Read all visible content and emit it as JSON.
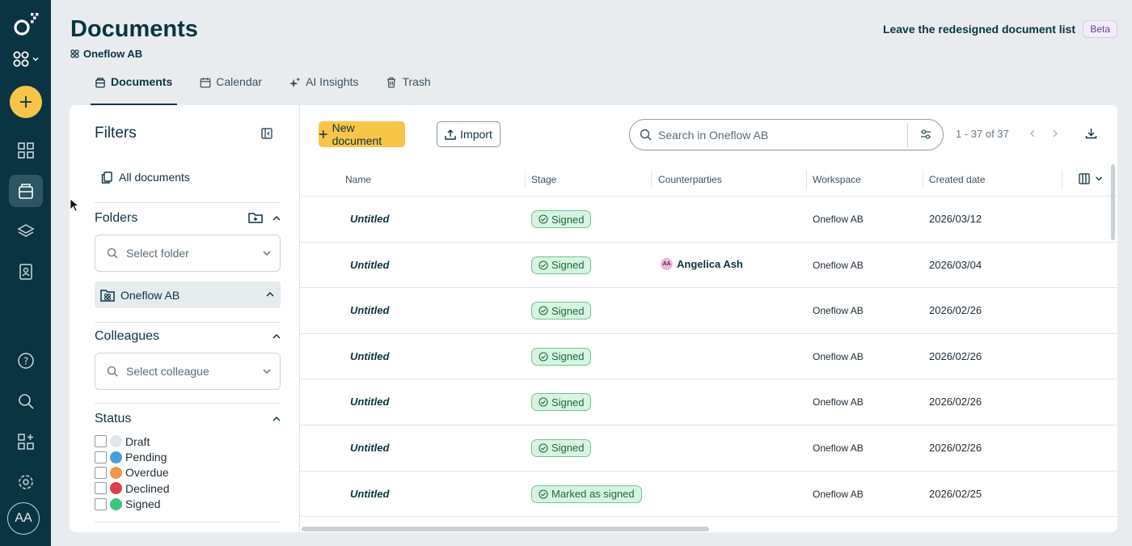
{
  "header": {
    "title": "Documents",
    "workspace": "Oneflow AB",
    "leave_link": "Leave the redesigned document list",
    "beta": "Beta"
  },
  "tabs": [
    {
      "label": "Documents",
      "icon": "documents-icon",
      "active": true
    },
    {
      "label": "Calendar",
      "icon": "calendar-icon"
    },
    {
      "label": "AI Insights",
      "icon": "sparkle-icon"
    },
    {
      "label": "Trash",
      "icon": "trash-icon"
    }
  ],
  "rail": {
    "avatar": "AA",
    "accent": "#f7c548",
    "background": "#0b3442"
  },
  "filters": {
    "title": "Filters",
    "all_documents": "All documents",
    "folders": {
      "title": "Folders",
      "placeholder": "Select folder",
      "selected_folder": "Oneflow AB"
    },
    "colleagues": {
      "title": "Colleagues",
      "placeholder": "Select colleague"
    },
    "status": {
      "title": "Status",
      "items": [
        {
          "label": "Draft",
          "color": "#e3e6e8"
        },
        {
          "label": "Pending",
          "color": "#4a9fd8"
        },
        {
          "label": "Overdue",
          "color": "#f0954a"
        },
        {
          "label": "Declined",
          "color": "#d9414c"
        },
        {
          "label": "Signed",
          "color": "#3fc47e"
        }
      ]
    }
  },
  "toolbar": {
    "new_document": "New document",
    "import": "Import",
    "search_placeholder": "Search in Oneflow AB",
    "pagination": "1 - 37 of 37"
  },
  "table": {
    "columns": [
      "Name",
      "Stage",
      "Counterparties",
      "Workspace",
      "Created date"
    ],
    "rows": [
      {
        "name": "Untitled",
        "stage": "Signed",
        "counterparty": "",
        "workspace": "Oneflow AB",
        "created": "2026/03/12"
      },
      {
        "name": "Untitled",
        "stage": "Signed",
        "counterparty": "Angelica Ash",
        "counterparty_initials": "AA",
        "workspace": "Oneflow AB",
        "created": "2026/03/04"
      },
      {
        "name": "Untitled",
        "stage": "Signed",
        "counterparty": "",
        "workspace": "Oneflow AB",
        "created": "2026/02/26"
      },
      {
        "name": "Untitled",
        "stage": "Signed",
        "counterparty": "",
        "workspace": "Oneflow AB",
        "created": "2026/02/26"
      },
      {
        "name": "Untitled",
        "stage": "Signed",
        "counterparty": "",
        "workspace": "Oneflow AB",
        "created": "2026/02/26"
      },
      {
        "name": "Untitled",
        "stage": "Signed",
        "counterparty": "",
        "workspace": "Oneflow AB",
        "created": "2026/02/26"
      },
      {
        "name": "Untitled",
        "stage": "Marked as signed",
        "counterparty": "",
        "workspace": "Oneflow AB",
        "created": "2026/02/25"
      }
    ]
  }
}
